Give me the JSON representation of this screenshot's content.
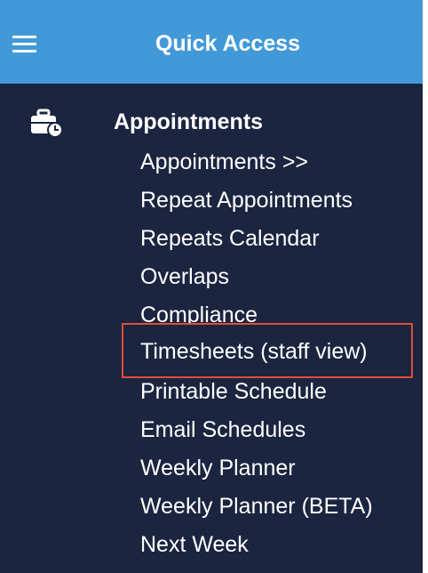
{
  "header": {
    "title": "Quick Access",
    "menu_icon": "hamburger-menu-icon",
    "background_color": "#4299d8"
  },
  "section": {
    "title": "Appointments",
    "icon": "briefcase-clock-icon",
    "items": [
      "Appointments >>",
      "Repeat Appointments",
      "Repeats Calendar",
      "Overlaps",
      "Compliance",
      "Timesheets (staff view)",
      "Printable Schedule",
      "Email Schedules",
      "Weekly Planner",
      "Weekly Planner (BETA)",
      "Next Week"
    ]
  },
  "theme": {
    "sidebar_background": "#1b2540",
    "highlight_border_color": "#e24d36",
    "text_color": "#ffffff"
  }
}
